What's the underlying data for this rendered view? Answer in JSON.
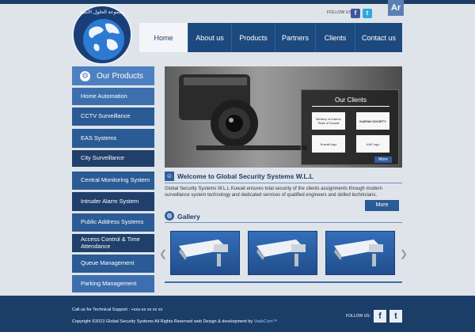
{
  "header": {
    "lang_button": "Ar",
    "follow_label": "FOLLOW US",
    "social": [
      {
        "name": "facebook",
        "glyph": "f",
        "color": "#3b5998"
      },
      {
        "name": "twitter",
        "glyph": "t",
        "color": "#2aa9e0"
      }
    ],
    "logo_text": "مجموعة الحلول الأمنية"
  },
  "nav": {
    "items": [
      {
        "label": "Home",
        "active": true
      },
      {
        "label": "About us"
      },
      {
        "label": "Products"
      },
      {
        "label": "Partners"
      },
      {
        "label": "Clients"
      },
      {
        "label": "Contact us"
      }
    ]
  },
  "sidebar": {
    "title": "Our Products",
    "items": [
      {
        "label": "Home Automation"
      },
      {
        "label": "CCTV Surveillance"
      },
      {
        "label": "EAS Systems"
      },
      {
        "label": "City Surveillance"
      },
      {
        "label": "Central Monitoring System"
      },
      {
        "label": "Intruder Alarm System"
      },
      {
        "label": "Public Address Systems"
      },
      {
        "label": "Access Control & Time Attendance"
      },
      {
        "label": "Queue Management"
      },
      {
        "label": "Parking Management"
      }
    ]
  },
  "clients": {
    "title": "Our Clients",
    "logos": [
      "Ministry of Interior State of Kuwait",
      "KAIFAN SOCIETY",
      "Kuwait logo",
      "UAE logo"
    ],
    "more": "More"
  },
  "welcome": {
    "title": "Welcome to Global Security Systems W.L.L",
    "text": "Global Security Systems W.L.L Kuwait ensures total security of the clients assignments through modern surveillance system technology and dedicated services of qualified engineers and skilled technicians.",
    "more": "More"
  },
  "gallery": {
    "title": "Gallery",
    "prev": "❮",
    "next": "❯"
  },
  "footer": {
    "support": "Call us for Technical Support : +xxx-xx xx xx xx",
    "copyright": "Copyright ©2013 Global Security Systems All Rights Reserved web Design & development by",
    "developer": "VadeCom™",
    "follow": "FOLLOW US:",
    "social": [
      "f",
      "t"
    ]
  },
  "colors": {
    "brand": "#1b3e69",
    "accent": "#4d80c0",
    "nav": "#1d4a7e"
  }
}
